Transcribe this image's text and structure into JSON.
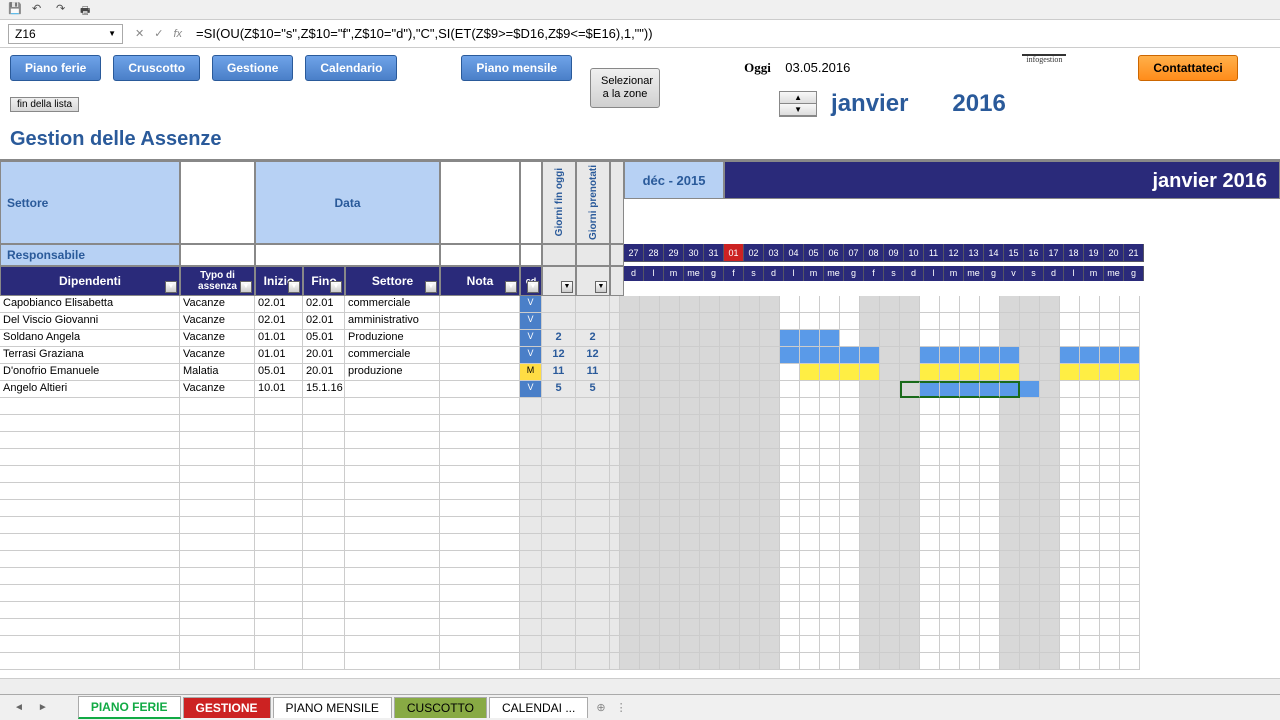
{
  "formula": {
    "cell_ref": "Z16",
    "content": "=SI(OU(Z$10=\"s\",Z$10=\"f\",Z$10=\"d\"),\"C\",SI(ET(Z$9>=$D16,Z$9<=$E16),1,\"\"))"
  },
  "buttons": {
    "piano_ferie": "Piano ferie",
    "cruscotto": "Cruscotto",
    "gestione": "Gestione",
    "calendario": "Calendario",
    "piano_mensile": "Piano mensile",
    "contattateci": "Contattateci",
    "fin_della_lista": "fin della lista",
    "selezionar_zona": "Selezionar a la zone"
  },
  "header": {
    "oggi_label": "Oggi",
    "oggi_date": "03.05.2016",
    "logo": "infogestion",
    "month": "janvier",
    "year": "2016"
  },
  "title": "Gestion delle Assenze",
  "grid_headers": {
    "settore": "Settore",
    "data": "Data",
    "responsabile": "Responsabile",
    "dipendenti": "Dipendenti",
    "tipo": "Typo di assenza",
    "inizio": "Inizio",
    "fino": "Fino",
    "settore2": "Settore",
    "nota": "Nota",
    "cd": "cd",
    "giorni_oggi": "Giorni fin oggi",
    "giorni_prenotati": "Giorni prenotati",
    "dec_2015": "déc - 2015",
    "jan_2016": "janvier 2016"
  },
  "dec_days": [
    "27",
    "28",
    "29",
    "30",
    "31"
  ],
  "dec_dow": [
    "d",
    "l",
    "m",
    "me",
    "g"
  ],
  "jan_days": [
    "01",
    "02",
    "03",
    "04",
    "05",
    "06",
    "07",
    "08",
    "09",
    "10",
    "11",
    "12",
    "13",
    "14",
    "15",
    "16",
    "17",
    "18",
    "19",
    "20",
    "21"
  ],
  "jan_dow": [
    "f",
    "s",
    "d",
    "l",
    "m",
    "me",
    "g",
    "f",
    "s",
    "d",
    "l",
    "m",
    "me",
    "g",
    "v",
    "s",
    "d",
    "l",
    "m",
    "me",
    "g"
  ],
  "rows": [
    {
      "name": "Capobianco Elisabetta",
      "tipo": "Vacanze",
      "inizio": "02.01",
      "fino": "02.01",
      "settore": "commerciale",
      "nota": "",
      "cd": "V",
      "g1": "",
      "g2": "",
      "days": []
    },
    {
      "name": "Del Viscio Giovanni",
      "tipo": "Vacanze",
      "inizio": "02.01",
      "fino": "02.01",
      "settore": "amministrativo",
      "nota": "",
      "cd": "V",
      "g1": "",
      "g2": "",
      "days": []
    },
    {
      "name": "Soldano Angela",
      "tipo": "Vacanze",
      "inizio": "01.01",
      "fino": "05.01",
      "settore": "Produzione",
      "nota": "",
      "cd": "V",
      "g1": "2",
      "g2": "2",
      "days": [
        8,
        9,
        10
      ]
    },
    {
      "name": "Terrasi Graziana",
      "tipo": "Vacanze",
      "inizio": "01.01",
      "fino": "20.01",
      "settore": "commerciale",
      "nota": "",
      "cd": "V",
      "g1": "12",
      "g2": "12",
      "days": [
        8,
        9,
        10,
        11,
        12,
        15,
        16,
        17,
        18,
        19,
        22,
        23,
        24,
        25
      ]
    },
    {
      "name": "D'onofrio Emanuele",
      "tipo": "Malatia",
      "inizio": "05.01",
      "fino": "20.01",
      "settore": "produzione",
      "nota": "",
      "cd": "M",
      "g1": "11",
      "g2": "11",
      "days": [
        9,
        10,
        11,
        12,
        15,
        16,
        17,
        18,
        19,
        22,
        23,
        24,
        25
      ]
    },
    {
      "name": "Angelo Altieri",
      "tipo": "Vacanze",
      "inizio": "10.01",
      "fino": "15.1.16",
      "settore": "",
      "nota": "",
      "cd": "V",
      "g1": "5",
      "g2": "5",
      "days": [
        15,
        16,
        17,
        18,
        19,
        20
      ]
    }
  ],
  "sheet_tabs": {
    "piano_ferie": "PIANO FERIE",
    "gestione": "GESTIONE",
    "piano_mensile": "PIANO MENSILE",
    "cuscotto": "CUSCOTTO",
    "calendar": "CALENDAI ..."
  }
}
